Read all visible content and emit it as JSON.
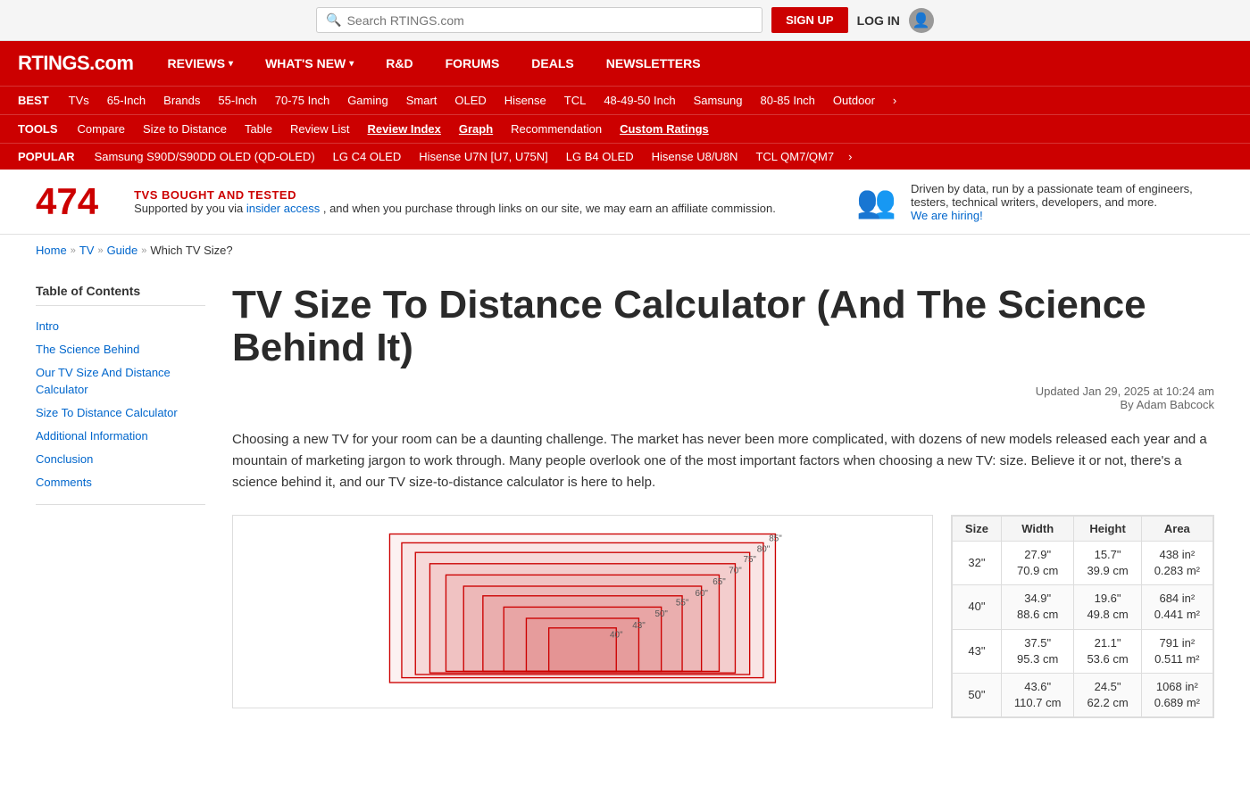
{
  "topbar": {
    "search_placeholder": "Search RTINGS.com",
    "signup_label": "SIGN UP",
    "login_label": "LOG IN"
  },
  "mainnav": {
    "logo": "RTINGS.com",
    "items": [
      {
        "label": "REVIEWS",
        "has_arrow": true
      },
      {
        "label": "WHAT'S NEW",
        "has_arrow": true
      },
      {
        "label": "R&D",
        "has_arrow": false
      },
      {
        "label": "FORUMS",
        "has_arrow": false
      },
      {
        "label": "DEALS",
        "has_arrow": false
      },
      {
        "label": "NEWSLETTERS",
        "has_arrow": false
      }
    ]
  },
  "best_nav": {
    "label": "BEST",
    "items": [
      "TVs",
      "65-Inch",
      "Brands",
      "55-Inch",
      "70-75 Inch",
      "Gaming",
      "Smart",
      "OLED",
      "Hisense",
      "TCL",
      "48-49-50 Inch",
      "Samsung",
      "80-85 Inch",
      "Outdoor"
    ]
  },
  "tools_nav": {
    "label": "TOOLS",
    "items": [
      "Compare",
      "Size to Distance",
      "Table",
      "Review List",
      "Review Index",
      "Graph",
      "Recommendation",
      "Custom Ratings"
    ]
  },
  "popular_nav": {
    "label": "POPULAR",
    "items": [
      "Samsung S90D/S90DD OLED (QD-OLED)",
      "LG C4 OLED",
      "Hisense U7N [U7, U75N]",
      "LG B4 OLED",
      "Hisense U8/U8N",
      "TCL QM7/QM7"
    ],
    "more": "›"
  },
  "stats": {
    "count": "474",
    "count_label": "TVS BOUGHT AND TESTED",
    "support_text": "Supported by you via",
    "support_link": "insider access",
    "support_suffix": ", and when you purchase through links on our site, we may earn an affiliate commission.",
    "right_text": "Driven by data, run by a passionate team of engineers, testers, technical writers, developers, and more.",
    "hiring_label": "We are hiring!",
    "hiring_link": "#"
  },
  "breadcrumb": {
    "items": [
      "Home",
      "TV",
      "Guide"
    ],
    "current": "Which TV Size?"
  },
  "toc": {
    "title": "Table of Contents",
    "items": [
      "Intro",
      "The Science Behind",
      "Our TV Size And Distance Calculator",
      "Size To Distance Calculator",
      "Additional Information",
      "Conclusion",
      "Comments"
    ]
  },
  "article": {
    "title": "TV Size To Distance Calculator (And The Science Behind It)",
    "updated": "Updated Jan 29, 2025 at 10:24 am",
    "author": "By Adam Babcock",
    "intro": "Choosing a new TV for your room can be a daunting challenge. The market has never been more complicated, with dozens of new models released each year and a mountain of marketing jargon to work through. Many people overlook one of the most important factors when choosing a new TV: size. Believe it or not, there's a science behind it, and our TV size-to-distance calculator is here to help."
  },
  "tv_sizes_diagram": {
    "labels": [
      "85\"",
      "80\"",
      "75\"",
      "70\"",
      "65\"",
      "60\"",
      "55\"",
      "50\"",
      "43\"",
      "40\""
    ],
    "colors": {
      "border": "#c00",
      "fill": "rgba(200,0,0,0.07)"
    }
  },
  "size_table": {
    "headers": [
      "Size",
      "Width",
      "Height",
      "Area"
    ],
    "rows": [
      {
        "size": "32\"",
        "width": "27.9\"\n70.9 cm",
        "height": "15.7\"\n39.9 cm",
        "area": "438 in²\n0.283 m²"
      },
      {
        "size": "40\"",
        "width": "34.9\"\n88.6 cm",
        "height": "19.6\"\n49.8 cm",
        "area": "684 in²\n0.441 m²"
      },
      {
        "size": "43\"",
        "width": "37.5\"\n95.3 cm",
        "height": "21.1\"\n53.6 cm",
        "area": "791 in²\n0.511 m²"
      },
      {
        "size": "50\"",
        "width": "43.6\"\n110.7 cm",
        "height": "24.5\"\n62.2 cm",
        "area": "1068 in²\n0.689 m²"
      }
    ]
  }
}
